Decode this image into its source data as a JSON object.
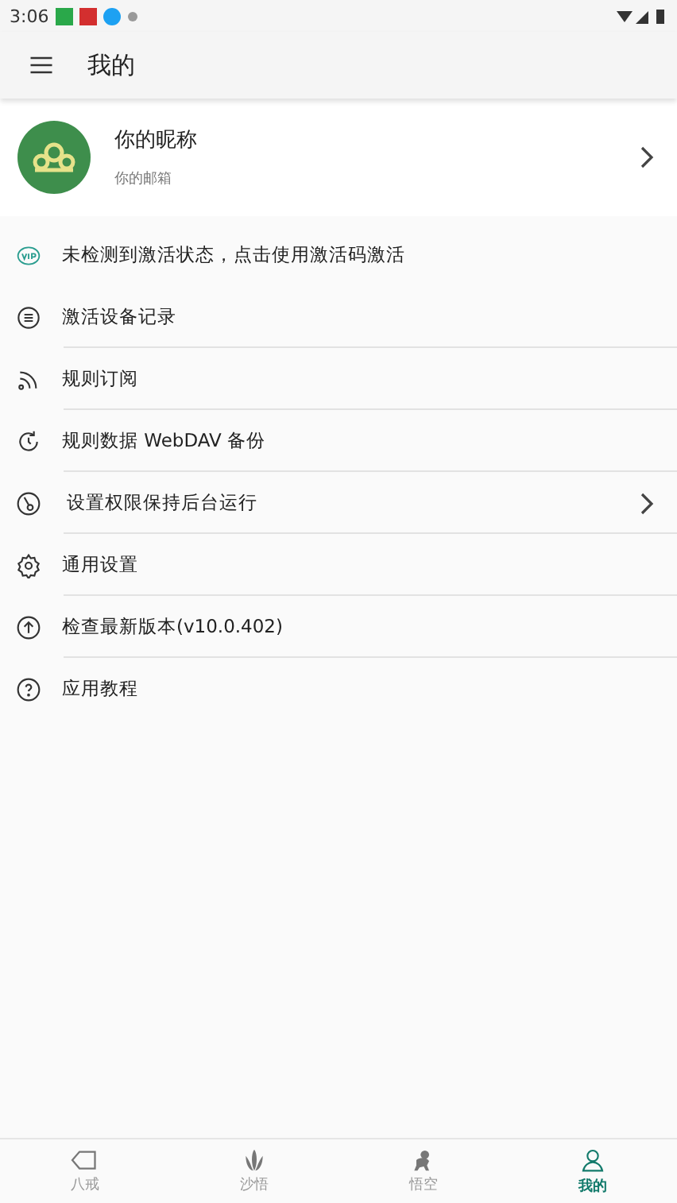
{
  "status_bar": {
    "time": "3:06"
  },
  "app_bar": {
    "title": "我的"
  },
  "profile": {
    "nickname": "你的昵称",
    "email": "你的邮箱",
    "chevron": true
  },
  "menu": [
    {
      "label": "未检测到激活状态，点击使用激活码激活",
      "chevron": false,
      "divider": false
    },
    {
      "label": "激活设备记录",
      "chevron": false,
      "divider": true
    },
    {
      "label": "规则订阅",
      "chevron": false,
      "divider": true
    },
    {
      "label": "规则数据 WebDAV 备份",
      "chevron": false,
      "divider": true
    },
    {
      "label": "设置权限保持后台运行",
      "chevron": true,
      "divider": true
    },
    {
      "label": "通用设置",
      "chevron": false,
      "divider": true
    },
    {
      "label": "检查最新版本(v10.0.402)",
      "chevron": false,
      "divider": true
    },
    {
      "label": "应用教程",
      "chevron": false,
      "divider": false
    }
  ],
  "bottom_nav": [
    {
      "label": "八戒",
      "selected": false
    },
    {
      "label": "沙悟",
      "selected": false
    },
    {
      "label": "悟空",
      "selected": false
    },
    {
      "label": "我的",
      "selected": true
    }
  ]
}
